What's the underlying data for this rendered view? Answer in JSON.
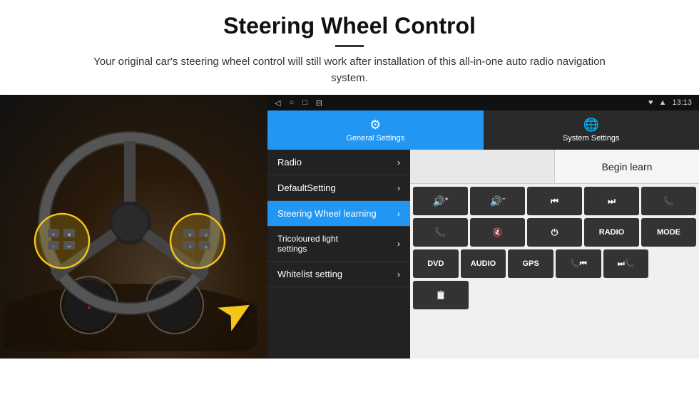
{
  "header": {
    "title": "Steering Wheel Control",
    "subtitle": "Your original car's steering wheel control will still work after installation of this all-in-one auto radio navigation system."
  },
  "status_bar": {
    "nav_icons": [
      "◁",
      "○",
      "□",
      "⊟"
    ],
    "right_icons": [
      "♥",
      "▲",
      "13:13"
    ]
  },
  "tabs": [
    {
      "label": "General Settings",
      "active": true
    },
    {
      "label": "System Settings",
      "active": false
    }
  ],
  "menu_items": [
    {
      "label": "Radio",
      "active": false
    },
    {
      "label": "DefaultSetting",
      "active": false
    },
    {
      "label": "Steering Wheel learning",
      "active": true
    },
    {
      "label": "Tricoloured light settings",
      "active": false
    },
    {
      "label": "Whitelist setting",
      "active": false
    }
  ],
  "begin_learn_label": "Begin learn",
  "control_buttons_row1": [
    {
      "symbol": "🔊+",
      "label": "vol-up"
    },
    {
      "symbol": "🔊-",
      "label": "vol-down"
    },
    {
      "symbol": "⏮",
      "label": "prev"
    },
    {
      "symbol": "⏭",
      "label": "next"
    },
    {
      "symbol": "📞",
      "label": "call"
    }
  ],
  "control_buttons_row2": [
    {
      "symbol": "📞↩",
      "label": "hang-up"
    },
    {
      "symbol": "🔇",
      "label": "mute"
    },
    {
      "symbol": "⏻",
      "label": "power"
    },
    {
      "symbol": "RADIO",
      "label": "radio"
    },
    {
      "symbol": "MODE",
      "label": "mode"
    }
  ],
  "control_buttons_row3": [
    {
      "symbol": "DVD",
      "label": "dvd"
    },
    {
      "symbol": "AUDIO",
      "label": "audio"
    },
    {
      "symbol": "GPS",
      "label": "gps"
    },
    {
      "symbol": "📞⏮",
      "label": "call-prev"
    },
    {
      "symbol": "⏭📞",
      "label": "call-next"
    }
  ],
  "control_buttons_row4": [
    {
      "symbol": "📋",
      "label": "list"
    }
  ]
}
